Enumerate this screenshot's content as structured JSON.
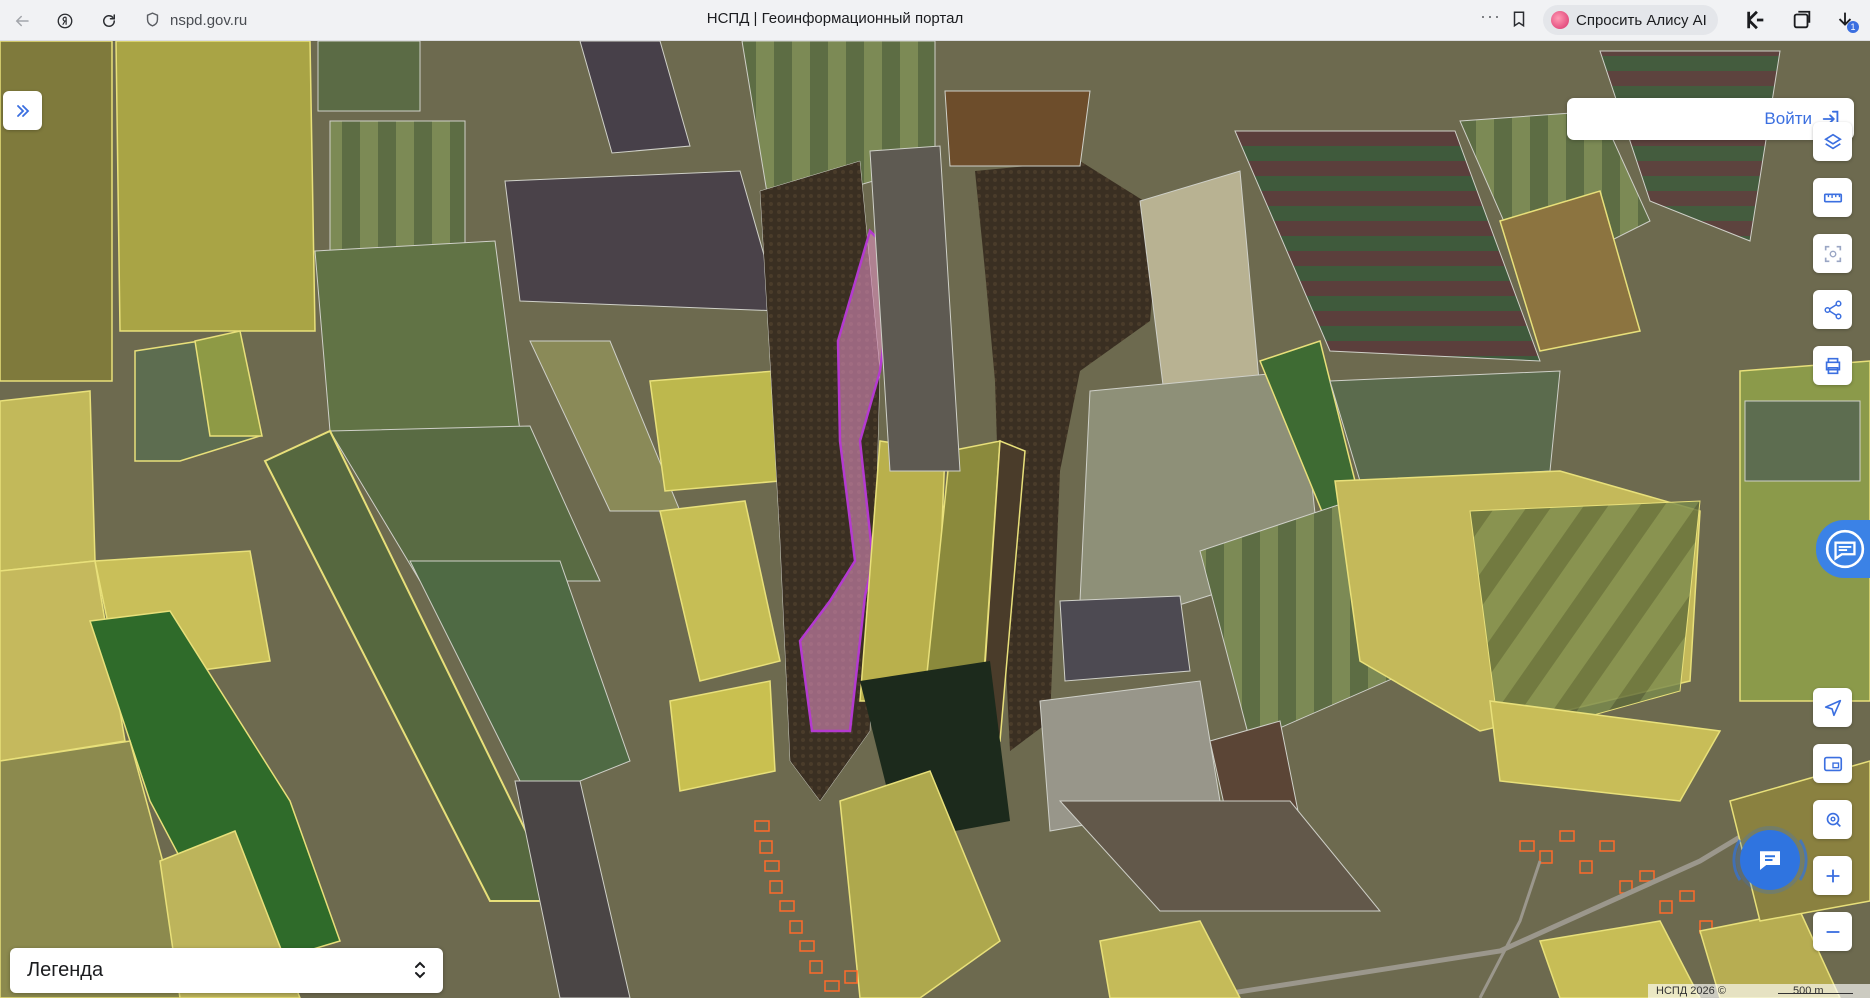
{
  "browser": {
    "url": "nspd.gov.ru",
    "page_title": "НСПД | Геоинформационный портал",
    "alice_label": "Спросить Алису AI",
    "more_dots": "···",
    "download_badge": "1"
  },
  "map": {
    "login_label": "Войти",
    "legend_label": "Легенда",
    "attribution": "НСПД 2026 ©",
    "scale_label": "500 m",
    "colors": {
      "parcel_outline": "#e8e07a",
      "selected_outline": "#b43ad0",
      "selected_fill": "#e893c8",
      "settlement": "#ff6a2a",
      "accent": "#3b6fe0"
    }
  },
  "controls": {
    "right_tools": [
      "layers-icon",
      "ruler-icon",
      "area-select-icon",
      "share-icon",
      "print-icon"
    ],
    "bottom_tools": [
      "navigate-icon",
      "minimap-icon",
      "locate-icon",
      "zoom-in-icon",
      "zoom-out-icon"
    ]
  }
}
